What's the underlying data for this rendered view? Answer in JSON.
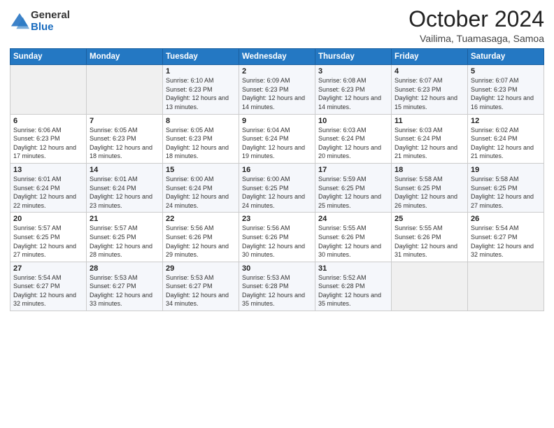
{
  "logo": {
    "general": "General",
    "blue": "Blue"
  },
  "header": {
    "month_year": "October 2024",
    "location": "Vailima, Tuamasaga, Samoa"
  },
  "weekdays": [
    "Sunday",
    "Monday",
    "Tuesday",
    "Wednesday",
    "Thursday",
    "Friday",
    "Saturday"
  ],
  "weeks": [
    [
      {
        "day": "",
        "sunrise": "",
        "sunset": "",
        "daylight": "",
        "empty": true
      },
      {
        "day": "",
        "sunrise": "",
        "sunset": "",
        "daylight": "",
        "empty": true
      },
      {
        "day": "1",
        "sunrise": "Sunrise: 6:10 AM",
        "sunset": "Sunset: 6:23 PM",
        "daylight": "Daylight: 12 hours and 13 minutes.",
        "empty": false
      },
      {
        "day": "2",
        "sunrise": "Sunrise: 6:09 AM",
        "sunset": "Sunset: 6:23 PM",
        "daylight": "Daylight: 12 hours and 14 minutes.",
        "empty": false
      },
      {
        "day": "3",
        "sunrise": "Sunrise: 6:08 AM",
        "sunset": "Sunset: 6:23 PM",
        "daylight": "Daylight: 12 hours and 14 minutes.",
        "empty": false
      },
      {
        "day": "4",
        "sunrise": "Sunrise: 6:07 AM",
        "sunset": "Sunset: 6:23 PM",
        "daylight": "Daylight: 12 hours and 15 minutes.",
        "empty": false
      },
      {
        "day": "5",
        "sunrise": "Sunrise: 6:07 AM",
        "sunset": "Sunset: 6:23 PM",
        "daylight": "Daylight: 12 hours and 16 minutes.",
        "empty": false
      }
    ],
    [
      {
        "day": "6",
        "sunrise": "Sunrise: 6:06 AM",
        "sunset": "Sunset: 6:23 PM",
        "daylight": "Daylight: 12 hours and 17 minutes.",
        "empty": false
      },
      {
        "day": "7",
        "sunrise": "Sunrise: 6:05 AM",
        "sunset": "Sunset: 6:23 PM",
        "daylight": "Daylight: 12 hours and 18 minutes.",
        "empty": false
      },
      {
        "day": "8",
        "sunrise": "Sunrise: 6:05 AM",
        "sunset": "Sunset: 6:23 PM",
        "daylight": "Daylight: 12 hours and 18 minutes.",
        "empty": false
      },
      {
        "day": "9",
        "sunrise": "Sunrise: 6:04 AM",
        "sunset": "Sunset: 6:24 PM",
        "daylight": "Daylight: 12 hours and 19 minutes.",
        "empty": false
      },
      {
        "day": "10",
        "sunrise": "Sunrise: 6:03 AM",
        "sunset": "Sunset: 6:24 PM",
        "daylight": "Daylight: 12 hours and 20 minutes.",
        "empty": false
      },
      {
        "day": "11",
        "sunrise": "Sunrise: 6:03 AM",
        "sunset": "Sunset: 6:24 PM",
        "daylight": "Daylight: 12 hours and 21 minutes.",
        "empty": false
      },
      {
        "day": "12",
        "sunrise": "Sunrise: 6:02 AM",
        "sunset": "Sunset: 6:24 PM",
        "daylight": "Daylight: 12 hours and 21 minutes.",
        "empty": false
      }
    ],
    [
      {
        "day": "13",
        "sunrise": "Sunrise: 6:01 AM",
        "sunset": "Sunset: 6:24 PM",
        "daylight": "Daylight: 12 hours and 22 minutes.",
        "empty": false
      },
      {
        "day": "14",
        "sunrise": "Sunrise: 6:01 AM",
        "sunset": "Sunset: 6:24 PM",
        "daylight": "Daylight: 12 hours and 23 minutes.",
        "empty": false
      },
      {
        "day": "15",
        "sunrise": "Sunrise: 6:00 AM",
        "sunset": "Sunset: 6:24 PM",
        "daylight": "Daylight: 12 hours and 24 minutes.",
        "empty": false
      },
      {
        "day": "16",
        "sunrise": "Sunrise: 6:00 AM",
        "sunset": "Sunset: 6:25 PM",
        "daylight": "Daylight: 12 hours and 24 minutes.",
        "empty": false
      },
      {
        "day": "17",
        "sunrise": "Sunrise: 5:59 AM",
        "sunset": "Sunset: 6:25 PM",
        "daylight": "Daylight: 12 hours and 25 minutes.",
        "empty": false
      },
      {
        "day": "18",
        "sunrise": "Sunrise: 5:58 AM",
        "sunset": "Sunset: 6:25 PM",
        "daylight": "Daylight: 12 hours and 26 minutes.",
        "empty": false
      },
      {
        "day": "19",
        "sunrise": "Sunrise: 5:58 AM",
        "sunset": "Sunset: 6:25 PM",
        "daylight": "Daylight: 12 hours and 27 minutes.",
        "empty": false
      }
    ],
    [
      {
        "day": "20",
        "sunrise": "Sunrise: 5:57 AM",
        "sunset": "Sunset: 6:25 PM",
        "daylight": "Daylight: 12 hours and 27 minutes.",
        "empty": false
      },
      {
        "day": "21",
        "sunrise": "Sunrise: 5:57 AM",
        "sunset": "Sunset: 6:25 PM",
        "daylight": "Daylight: 12 hours and 28 minutes.",
        "empty": false
      },
      {
        "day": "22",
        "sunrise": "Sunrise: 5:56 AM",
        "sunset": "Sunset: 6:26 PM",
        "daylight": "Daylight: 12 hours and 29 minutes.",
        "empty": false
      },
      {
        "day": "23",
        "sunrise": "Sunrise: 5:56 AM",
        "sunset": "Sunset: 6:26 PM",
        "daylight": "Daylight: 12 hours and 30 minutes.",
        "empty": false
      },
      {
        "day": "24",
        "sunrise": "Sunrise: 5:55 AM",
        "sunset": "Sunset: 6:26 PM",
        "daylight": "Daylight: 12 hours and 30 minutes.",
        "empty": false
      },
      {
        "day": "25",
        "sunrise": "Sunrise: 5:55 AM",
        "sunset": "Sunset: 6:26 PM",
        "daylight": "Daylight: 12 hours and 31 minutes.",
        "empty": false
      },
      {
        "day": "26",
        "sunrise": "Sunrise: 5:54 AM",
        "sunset": "Sunset: 6:27 PM",
        "daylight": "Daylight: 12 hours and 32 minutes.",
        "empty": false
      }
    ],
    [
      {
        "day": "27",
        "sunrise": "Sunrise: 5:54 AM",
        "sunset": "Sunset: 6:27 PM",
        "daylight": "Daylight: 12 hours and 32 minutes.",
        "empty": false
      },
      {
        "day": "28",
        "sunrise": "Sunrise: 5:53 AM",
        "sunset": "Sunset: 6:27 PM",
        "daylight": "Daylight: 12 hours and 33 minutes.",
        "empty": false
      },
      {
        "day": "29",
        "sunrise": "Sunrise: 5:53 AM",
        "sunset": "Sunset: 6:27 PM",
        "daylight": "Daylight: 12 hours and 34 minutes.",
        "empty": false
      },
      {
        "day": "30",
        "sunrise": "Sunrise: 5:53 AM",
        "sunset": "Sunset: 6:28 PM",
        "daylight": "Daylight: 12 hours and 35 minutes.",
        "empty": false
      },
      {
        "day": "31",
        "sunrise": "Sunrise: 5:52 AM",
        "sunset": "Sunset: 6:28 PM",
        "daylight": "Daylight: 12 hours and 35 minutes.",
        "empty": false
      },
      {
        "day": "",
        "sunrise": "",
        "sunset": "",
        "daylight": "",
        "empty": true
      },
      {
        "day": "",
        "sunrise": "",
        "sunset": "",
        "daylight": "",
        "empty": true
      }
    ]
  ]
}
